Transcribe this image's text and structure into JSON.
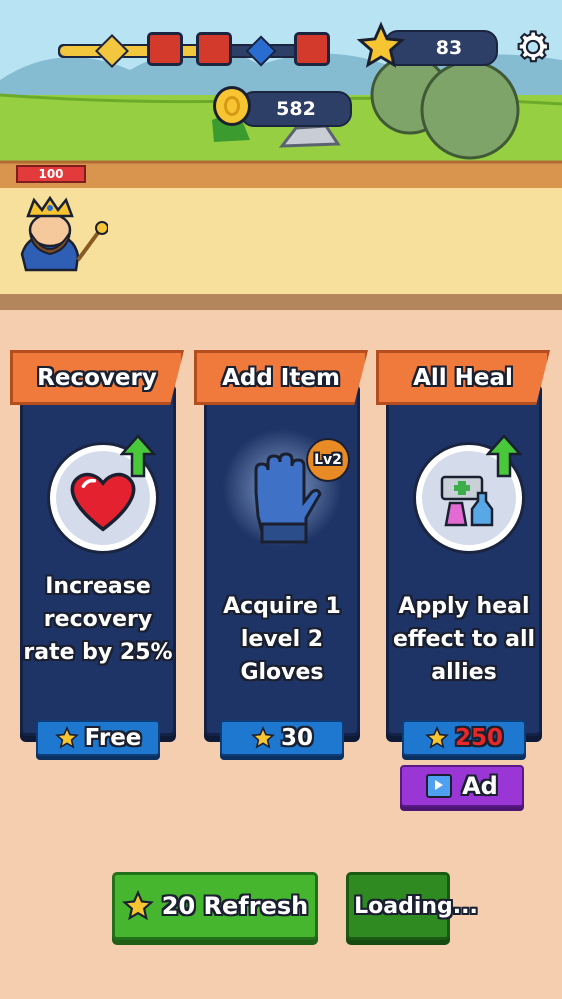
{
  "hud": {
    "stars": "83",
    "coins": "582",
    "hero_hp": "100"
  },
  "cards": [
    {
      "title": "Recovery",
      "description": "Increase recovery rate by 25%",
      "price": "Free",
      "icon": "heart-icon",
      "badge": ""
    },
    {
      "title": "Add Item",
      "description": "Acquire 1 level 2 Gloves",
      "price": "30",
      "icon": "gloves-icon",
      "badge": "Lv2"
    },
    {
      "title": "All Heal",
      "description": "Apply heal effect to all allies",
      "price": "250",
      "icon": "potions-icon",
      "badge": ""
    }
  ],
  "ad_button": {
    "label": "Ad"
  },
  "refresh_button": {
    "label": "20 Refresh"
  },
  "loading_button": {
    "label": "Loading..."
  },
  "colors": {
    "price_insufficient": "#e82828",
    "orange_tab": "#f07a3c",
    "card_navy": "#1e3466",
    "green_button": "#45b62e",
    "purple_button": "#9a35d6"
  }
}
